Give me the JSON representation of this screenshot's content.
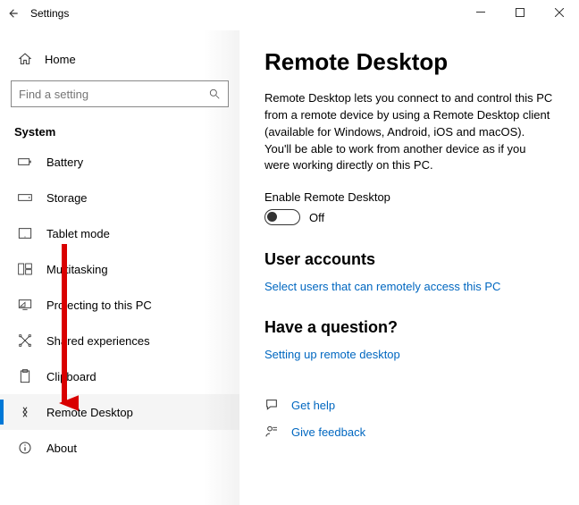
{
  "titlebar": {
    "title": "Settings"
  },
  "sidebar": {
    "home_label": "Home",
    "search_placeholder": "Find a setting",
    "section": "System",
    "items": [
      {
        "label": "Battery",
        "icon": "battery"
      },
      {
        "label": "Storage",
        "icon": "storage"
      },
      {
        "label": "Tablet mode",
        "icon": "tablet"
      },
      {
        "label": "Multitasking",
        "icon": "multitask"
      },
      {
        "label": "Projecting to this PC",
        "icon": "project"
      },
      {
        "label": "Shared experiences",
        "icon": "shared"
      },
      {
        "label": "Clipboard",
        "icon": "clipboard"
      },
      {
        "label": "Remote Desktop",
        "icon": "remote",
        "selected": true
      },
      {
        "label": "About",
        "icon": "about"
      }
    ]
  },
  "main": {
    "heading": "Remote Desktop",
    "description": "Remote Desktop lets you connect to and control this PC from a remote device by using a Remote Desktop client (available for Windows, Android, iOS and macOS). You'll be able to work from another device as if you were working directly on this PC.",
    "toggle_label": "Enable Remote Desktop",
    "toggle_state": "Off",
    "user_accounts_heading": "User accounts",
    "user_accounts_link": "Select users that can remotely access this PC",
    "question_heading": "Have a question?",
    "question_link": "Setting up remote desktop",
    "help": [
      {
        "icon": "chat",
        "label": "Get help"
      },
      {
        "icon": "feedback",
        "label": "Give feedback"
      }
    ]
  }
}
